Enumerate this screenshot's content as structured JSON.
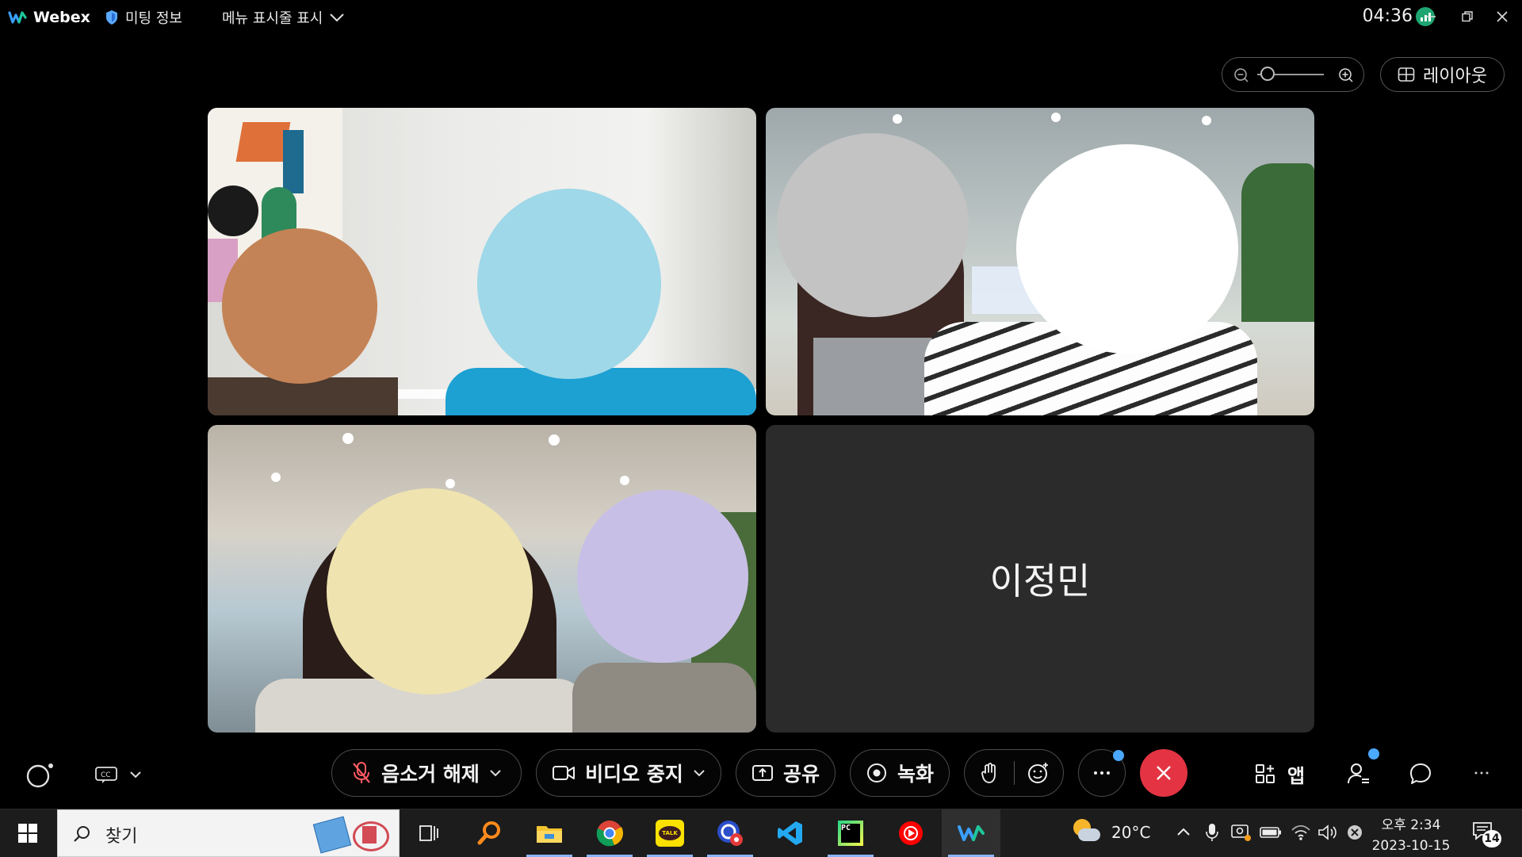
{
  "topbar": {
    "brand": "Webex",
    "meeting_info": "미팅 정보",
    "menu_bar_toggle": "메뉴 표시줄 표시",
    "elapsed_time": "04:36"
  },
  "view_controls": {
    "layout_label": "레이아웃",
    "zoom_level": 0.15
  },
  "participants": {
    "empty_tile_name": "이정민"
  },
  "controls": {
    "unmute_label": "음소거 해제",
    "stop_video_label": "비디오 중지",
    "share_label": "공유",
    "record_label": "녹화",
    "apps_label": "앱"
  },
  "taskbar": {
    "search_placeholder": "찾기",
    "weather_temp": "20°C",
    "time": "오후 2:34",
    "date": "2023-10-15",
    "notification_count": "14"
  },
  "colors": {
    "end_call_red": "#e43443",
    "badge_blue": "#4aa8ff",
    "signal_green": "#1ea672",
    "empty_tile_bg": "#2b2b2b"
  }
}
